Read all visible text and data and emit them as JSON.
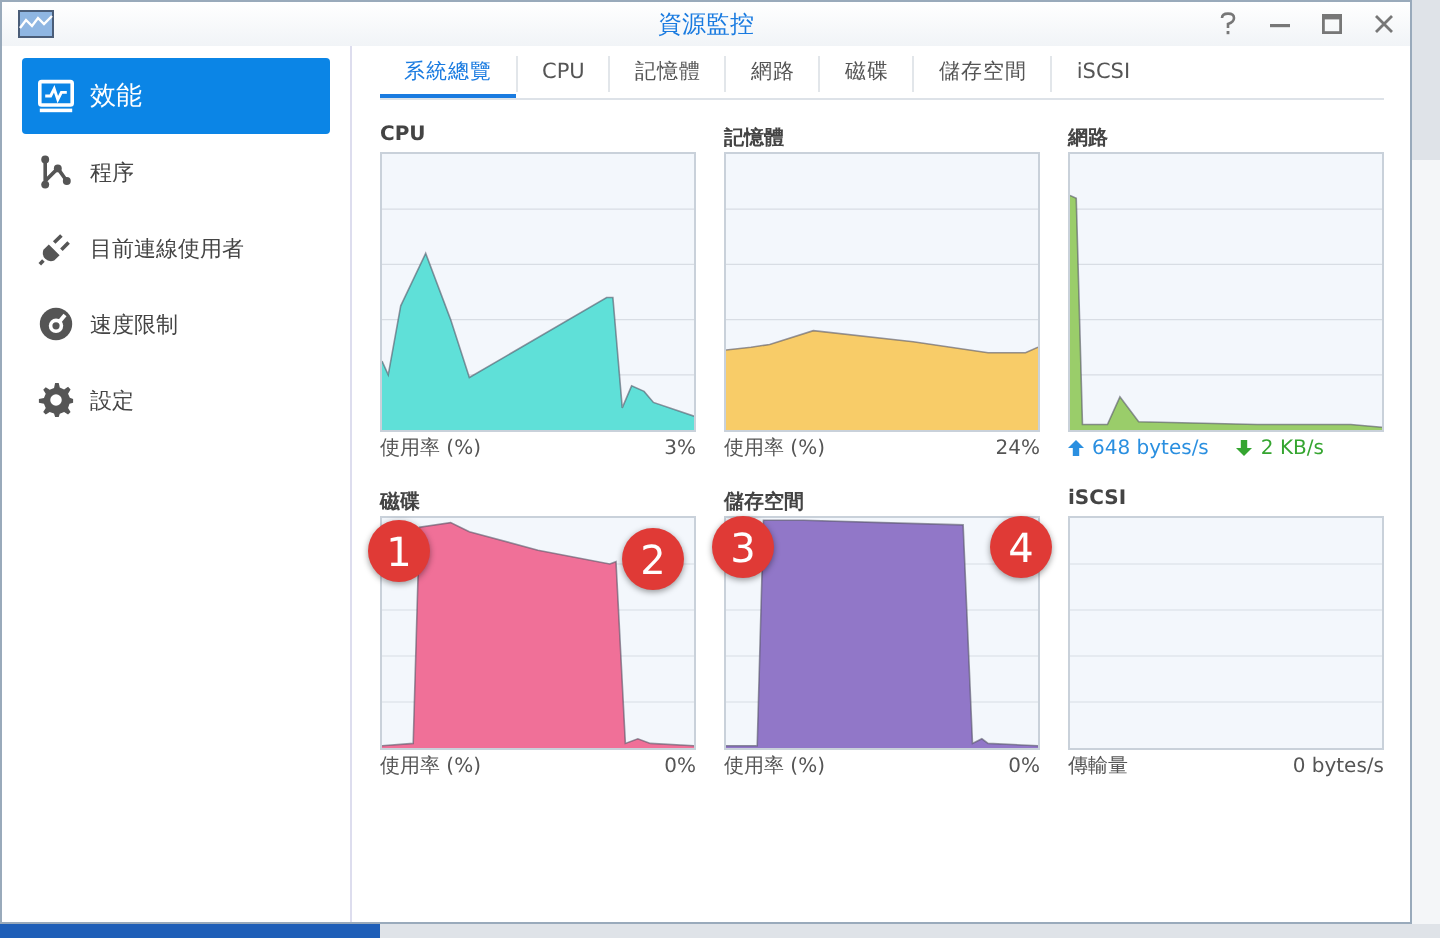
{
  "window": {
    "title": "資源監控"
  },
  "sidebar": {
    "items": [
      {
        "label": "效能",
        "selected": true
      },
      {
        "label": "程序",
        "selected": false
      },
      {
        "label": "目前連線使用者",
        "selected": false
      },
      {
        "label": "速度限制",
        "selected": false
      },
      {
        "label": "設定",
        "selected": false
      }
    ]
  },
  "tabs": [
    {
      "label": "系統總覽",
      "selected": true
    },
    {
      "label": "CPU",
      "selected": false
    },
    {
      "label": "記憶體",
      "selected": false
    },
    {
      "label": "網路",
      "selected": false
    },
    {
      "label": "磁碟",
      "selected": false
    },
    {
      "label": "儲存空間",
      "selected": false
    },
    {
      "label": "iSCSI",
      "selected": false
    }
  ],
  "charts": [
    {
      "title": "CPU",
      "kind": "usage",
      "color": "#5fe0d8",
      "label": "使用率 (%)",
      "value": "3%"
    },
    {
      "title": "記憶體",
      "kind": "usage",
      "color": "#f8cc68",
      "label": "使用率 (%)",
      "value": "24%"
    },
    {
      "title": "網路",
      "kind": "network",
      "color": "#9acd6a",
      "upload": "648 bytes/s",
      "download": "2 KB/s"
    },
    {
      "title": "磁碟",
      "kind": "usage",
      "color": "#f07098",
      "label": "使用率 (%)",
      "value": "0%",
      "badges": [
        "1",
        "2"
      ]
    },
    {
      "title": "儲存空間",
      "kind": "usage",
      "color": "#9177c8",
      "label": "使用率 (%)",
      "value": "0%",
      "badges": [
        "3",
        "4"
      ]
    },
    {
      "title": "iSCSI",
      "kind": "usage",
      "label": "傳輸量",
      "value": "0 bytes/s"
    }
  ]
}
